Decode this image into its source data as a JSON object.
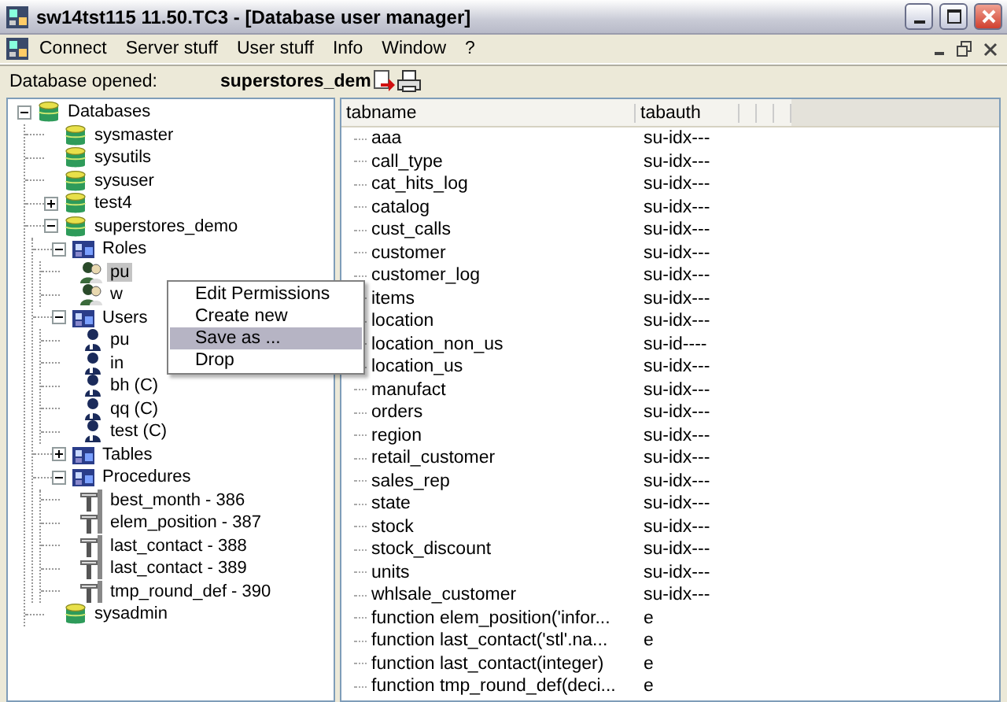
{
  "window": {
    "title": "sw14tst115 11.50.TC3 - [Database user manager]"
  },
  "menu": [
    "Connect",
    "Server stuff",
    "User stuff",
    "Info",
    "Window",
    "?"
  ],
  "toolbar": {
    "label": "Database opened:",
    "database": "superstores_dem"
  },
  "tree": [
    {
      "label": "Databases",
      "kind": "database",
      "expanded": true,
      "selected": false,
      "children": [
        {
          "label": "sysmaster",
          "kind": "database",
          "selected": false
        },
        {
          "label": "sysutils",
          "kind": "database",
          "selected": false
        },
        {
          "label": "sysuser",
          "kind": "database",
          "selected": false
        },
        {
          "label": "test4",
          "kind": "database",
          "expanded": false,
          "selected": false
        },
        {
          "label": "superstores_demo",
          "kind": "database",
          "expanded": true,
          "selected": false,
          "children": [
            {
              "label": "Roles",
              "kind": "folder",
              "expanded": true,
              "selected": false,
              "children": [
                {
                  "label": "pu",
                  "kind": "role",
                  "selected": true
                },
                {
                  "label": "w",
                  "kind": "role",
                  "selected": false
                }
              ]
            },
            {
              "label": "Users",
              "kind": "folder",
              "expanded": true,
              "selected": false,
              "children": [
                {
                  "label": "pu",
                  "kind": "user",
                  "selected": false
                },
                {
                  "label": "in",
                  "kind": "user",
                  "selected": false
                },
                {
                  "label": "bh (C)",
                  "kind": "user",
                  "selected": false
                },
                {
                  "label": "qq (C)",
                  "kind": "user",
                  "selected": false
                },
                {
                  "label": "test (C)",
                  "kind": "user",
                  "selected": false
                }
              ]
            },
            {
              "label": "Tables",
              "kind": "folder",
              "expanded": false,
              "selected": false
            },
            {
              "label": "Procedures",
              "kind": "folder",
              "expanded": true,
              "selected": false,
              "children": [
                {
                  "label": "best_month - 386",
                  "kind": "procedure",
                  "selected": false
                },
                {
                  "label": "elem_position - 387",
                  "kind": "procedure",
                  "selected": false
                },
                {
                  "label": "last_contact - 388",
                  "kind": "procedure",
                  "selected": false
                },
                {
                  "label": "last_contact - 389",
                  "kind": "procedure",
                  "selected": false
                },
                {
                  "label": "tmp_round_def - 390",
                  "kind": "procedure",
                  "selected": false
                }
              ]
            }
          ]
        },
        {
          "label": "sysadmin",
          "kind": "database",
          "selected": false
        }
      ]
    }
  ],
  "context_menu": [
    {
      "label": "Edit Permissions",
      "selected": false
    },
    {
      "label": "Create new",
      "selected": false
    },
    {
      "label": "Save as ...",
      "selected": true
    },
    {
      "label": "Drop",
      "selected": false
    }
  ],
  "table": {
    "columns": [
      "tabname",
      "tabauth"
    ],
    "rows": [
      {
        "tabname": "aaa",
        "tabauth": "su-idx---"
      },
      {
        "tabname": "call_type",
        "tabauth": "su-idx---"
      },
      {
        "tabname": "cat_hits_log",
        "tabauth": "su-idx---"
      },
      {
        "tabname": "catalog",
        "tabauth": "su-idx---"
      },
      {
        "tabname": "cust_calls",
        "tabauth": "su-idx---"
      },
      {
        "tabname": "customer",
        "tabauth": "su-idx---"
      },
      {
        "tabname": "customer_log",
        "tabauth": "su-idx---"
      },
      {
        "tabname": "items",
        "tabauth": "su-idx---"
      },
      {
        "tabname": "location",
        "tabauth": "su-idx---"
      },
      {
        "tabname": "location_non_us",
        "tabauth": "su-id----"
      },
      {
        "tabname": "location_us",
        "tabauth": "su-idx---"
      },
      {
        "tabname": "manufact",
        "tabauth": "su-idx---"
      },
      {
        "tabname": "orders",
        "tabauth": "su-idx---"
      },
      {
        "tabname": "region",
        "tabauth": "su-idx---"
      },
      {
        "tabname": "retail_customer",
        "tabauth": "su-idx---"
      },
      {
        "tabname": "sales_rep",
        "tabauth": "su-idx---"
      },
      {
        "tabname": "state",
        "tabauth": "su-idx---"
      },
      {
        "tabname": "stock",
        "tabauth": "su-idx---"
      },
      {
        "tabname": "stock_discount",
        "tabauth": "su-idx---"
      },
      {
        "tabname": "units",
        "tabauth": "su-idx---"
      },
      {
        "tabname": "whlsale_customer",
        "tabauth": "su-idx---"
      },
      {
        "tabname": "function elem_position('infor...",
        "tabauth": "e"
      },
      {
        "tabname": "function last_contact('stl'.na...",
        "tabauth": "e"
      },
      {
        "tabname": "function last_contact(integer)",
        "tabauth": "e"
      },
      {
        "tabname": "function tmp_round_def(deci...",
        "tabauth": "e"
      }
    ]
  }
}
